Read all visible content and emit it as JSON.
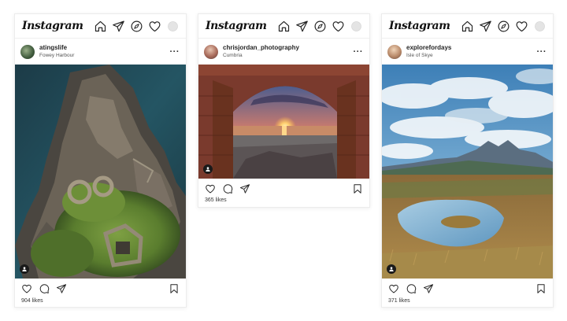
{
  "app": {
    "logo_text": "Instagram"
  },
  "nav_icons": [
    "home-icon",
    "direct-send-icon",
    "explore-compass-icon",
    "activity-heart-icon",
    "profile-avatar-icon"
  ],
  "posts": [
    {
      "username": "atingslife",
      "location": "Fowey Harbour",
      "likes": "904 likes",
      "photo_subject": "aerial coastal ruins"
    },
    {
      "username": "chrisjordan_photography",
      "location": "Cumbria",
      "likes": "365 likes",
      "photo_subject": "sunset through stone arch"
    },
    {
      "username": "explorefordays",
      "location": "Isle of Skye",
      "likes": "371 likes",
      "photo_subject": "mountains and loch"
    }
  ],
  "post_actions": [
    "like-heart-icon",
    "comment-icon",
    "share-send-icon",
    "save-bookmark-icon"
  ],
  "colors": {
    "text": "#262626",
    "border": "#ececec",
    "background": "#ffffff"
  }
}
